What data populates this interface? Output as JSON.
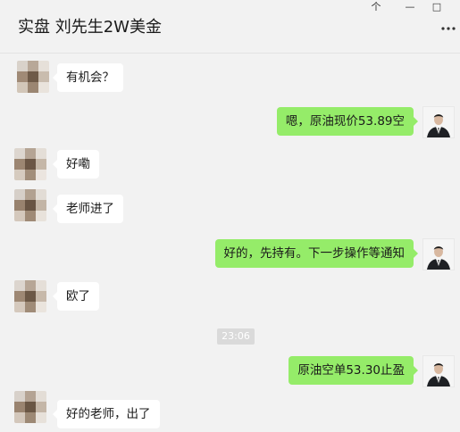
{
  "window": {
    "title": "实盘 刘先生2W美金",
    "pin_glyph": "个",
    "minimize_glyph": "—",
    "maximize_glyph": "□"
  },
  "messages": [
    {
      "side": "left",
      "text": "有机会？"
    },
    {
      "side": "right",
      "text": "嗯，原油现价53.89空"
    },
    {
      "side": "left",
      "text": "好嘞"
    },
    {
      "side": "left",
      "text": "老师进了"
    },
    {
      "side": "right",
      "text": "好的，先持有。下一步操作等通知"
    },
    {
      "side": "left",
      "text": "欧了"
    },
    {
      "type": "time",
      "text": "23:06"
    },
    {
      "side": "right",
      "text": "原油空单53.30止盈"
    },
    {
      "side": "left",
      "text": "好的老师，出了"
    }
  ],
  "colors": {
    "background": "#f2f2f2",
    "bubble_self": "#95ec69",
    "bubble_other": "#ffffff"
  }
}
